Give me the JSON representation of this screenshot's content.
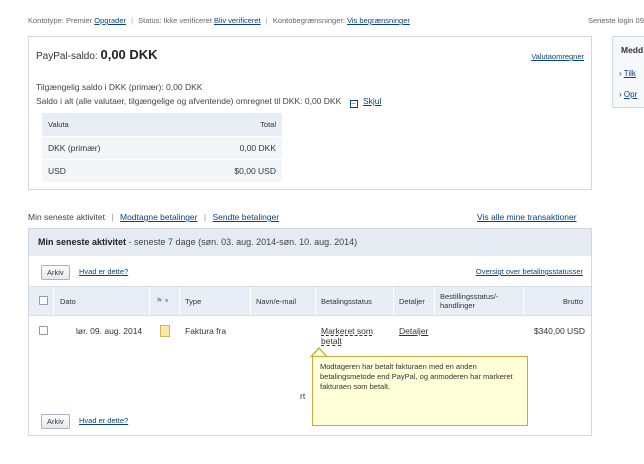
{
  "topbar": {
    "account_type_label": "Kontotype: Premier",
    "upgrade_link": "Opgrader",
    "status_label": "Status: Ikke verificeret",
    "verify_link": "Bliv verificeret",
    "limits_label": "Kontobegrænsninger:",
    "limits_link": "Vis begrænsninger",
    "last_login": "Seneste login 09:"
  },
  "balance": {
    "title_prefix": "PayPal-saldo:",
    "amount": "0,00 DKK",
    "currency_converter_link": "Valutaomregner",
    "available_line": "Tilgængelig saldo i DKK (primær): 0,00 DKK",
    "total_line": "Saldo i alt (alle valutaer, tilgængelige og afventende) omregnet til DKK: 0,00 DKK",
    "hide_link": "Skjul",
    "table": {
      "headers": [
        "Valuta",
        "Total"
      ],
      "rows": [
        {
          "currency": "DKK (primær)",
          "total": "0,00 DKK"
        },
        {
          "currency": "USD",
          "total": "$0,00 USD"
        }
      ]
    }
  },
  "side": {
    "title": "Medd",
    "links": [
      "Tilk",
      "Opr"
    ]
  },
  "activity_nav": {
    "current": "Min seneste aktivitet",
    "received_link": "Modtagne betalinger",
    "sent_link": "Sendte betalinger",
    "all_link": "Vis alle mine transaktioner"
  },
  "activity": {
    "header_bold": "Min seneste aktivitet",
    "header_rest": " - seneste 7 dage (søn. 03. aug. 2014-søn. 10. aug. 2014)",
    "archive_button": "Arkiv",
    "what_link": "Hvad er dette?",
    "overview_link": "Oversigt over betalingsstatusser",
    "columns": {
      "date": "Dato",
      "type": "Type",
      "name": "Navn/e-mail",
      "payment_status": "Betalingsstatus",
      "details": "Detaljer",
      "order_status": "Bestillingsstatus/-handlinger",
      "gross": "Brutto"
    },
    "row": {
      "date": "lør. 09. aug. 2014",
      "type": "Faktura fra",
      "status": "Markeret som betalt",
      "details": "Detaljer",
      "gross": "$340,00 USD"
    },
    "partial_text": "rt",
    "tooltip": "Modtageren har betalt fakturaen med en anden betalingsmetode end PayPal, og anmoderen har markeret fakturaen som betalt."
  }
}
